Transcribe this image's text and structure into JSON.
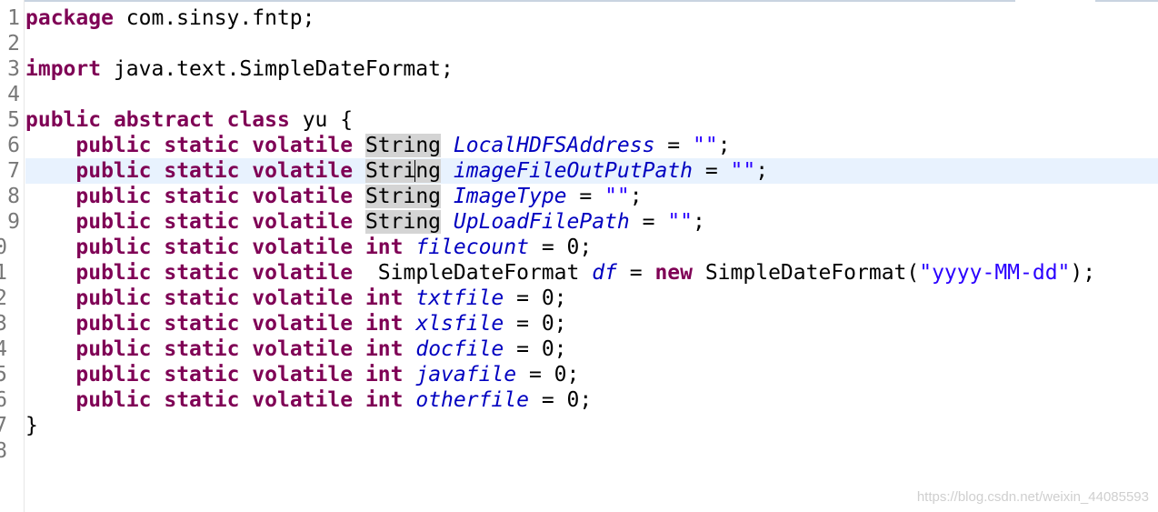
{
  "editor": {
    "current_line_index": 6,
    "colors": {
      "keyword": "#7f0055",
      "field": "#0000c0",
      "string": "#2a00ff",
      "line_number": "#787878",
      "current_line": "#e8f2fe",
      "occurrence_highlight": "#d4d4d4"
    },
    "lines": [
      {
        "num": "1",
        "tokens": [
          {
            "t": "kw",
            "v": "package"
          },
          {
            "t": "plain",
            "v": " com.sinsy.fntp;"
          }
        ]
      },
      {
        "num": "2",
        "tokens": []
      },
      {
        "num": "3",
        "tokens": [
          {
            "t": "kw",
            "v": "import"
          },
          {
            "t": "plain",
            "v": " java.text.SimpleDateFormat;"
          }
        ]
      },
      {
        "num": "4",
        "tokens": []
      },
      {
        "num": "5",
        "tokens": [
          {
            "t": "kw",
            "v": "public"
          },
          {
            "t": "plain",
            "v": " "
          },
          {
            "t": "kw",
            "v": "abstract"
          },
          {
            "t": "plain",
            "v": " "
          },
          {
            "t": "kw",
            "v": "class"
          },
          {
            "t": "plain",
            "v": " yu {"
          }
        ]
      },
      {
        "num": "6",
        "tokens": [
          {
            "t": "plain",
            "v": "    "
          },
          {
            "t": "kw",
            "v": "public"
          },
          {
            "t": "plain",
            "v": " "
          },
          {
            "t": "kw",
            "v": "static"
          },
          {
            "t": "plain",
            "v": " "
          },
          {
            "t": "kw",
            "v": "volatile"
          },
          {
            "t": "plain",
            "v": " "
          },
          {
            "t": "hl",
            "v": "String"
          },
          {
            "t": "plain",
            "v": " "
          },
          {
            "t": "fld",
            "v": "LocalHDFSAddress"
          },
          {
            "t": "plain",
            "v": " = "
          },
          {
            "t": "str",
            "v": "\"\""
          },
          {
            "t": "plain",
            "v": ";"
          }
        ]
      },
      {
        "num": "7",
        "tokens": [
          {
            "t": "plain",
            "v": "    "
          },
          {
            "t": "kw",
            "v": "public"
          },
          {
            "t": "plain",
            "v": " "
          },
          {
            "t": "kw",
            "v": "static"
          },
          {
            "t": "plain",
            "v": " "
          },
          {
            "t": "kw",
            "v": "volatile"
          },
          {
            "t": "plain",
            "v": " "
          },
          {
            "t": "hl",
            "v": "Stri"
          },
          {
            "t": "caret",
            "v": ""
          },
          {
            "t": "hl",
            "v": "ng"
          },
          {
            "t": "plain",
            "v": " "
          },
          {
            "t": "fld",
            "v": "imageFileOutPutPath"
          },
          {
            "t": "plain",
            "v": " = "
          },
          {
            "t": "str",
            "v": "\"\""
          },
          {
            "t": "plain",
            "v": ";"
          }
        ]
      },
      {
        "num": "8",
        "tokens": [
          {
            "t": "plain",
            "v": "    "
          },
          {
            "t": "kw",
            "v": "public"
          },
          {
            "t": "plain",
            "v": " "
          },
          {
            "t": "kw",
            "v": "static"
          },
          {
            "t": "plain",
            "v": " "
          },
          {
            "t": "kw",
            "v": "volatile"
          },
          {
            "t": "plain",
            "v": " "
          },
          {
            "t": "hl",
            "v": "String"
          },
          {
            "t": "plain",
            "v": " "
          },
          {
            "t": "fld",
            "v": "ImageType"
          },
          {
            "t": "plain",
            "v": " = "
          },
          {
            "t": "str",
            "v": "\"\""
          },
          {
            "t": "plain",
            "v": ";"
          }
        ]
      },
      {
        "num": "9",
        "tokens": [
          {
            "t": "plain",
            "v": "    "
          },
          {
            "t": "kw",
            "v": "public"
          },
          {
            "t": "plain",
            "v": " "
          },
          {
            "t": "kw",
            "v": "static"
          },
          {
            "t": "plain",
            "v": " "
          },
          {
            "t": "kw",
            "v": "volatile"
          },
          {
            "t": "plain",
            "v": " "
          },
          {
            "t": "hl",
            "v": "String"
          },
          {
            "t": "plain",
            "v": " "
          },
          {
            "t": "fld",
            "v": "UpLoadFilePath"
          },
          {
            "t": "plain",
            "v": " = "
          },
          {
            "t": "str",
            "v": "\"\""
          },
          {
            "t": "plain",
            "v": ";"
          }
        ]
      },
      {
        "num": "0",
        "tokens": [
          {
            "t": "plain",
            "v": "    "
          },
          {
            "t": "kw",
            "v": "public"
          },
          {
            "t": "plain",
            "v": " "
          },
          {
            "t": "kw",
            "v": "static"
          },
          {
            "t": "plain",
            "v": " "
          },
          {
            "t": "kw",
            "v": "volatile"
          },
          {
            "t": "plain",
            "v": " "
          },
          {
            "t": "kw",
            "v": "int"
          },
          {
            "t": "plain",
            "v": " "
          },
          {
            "t": "fld",
            "v": "filecount"
          },
          {
            "t": "plain",
            "v": " = 0;"
          }
        ]
      },
      {
        "num": "1",
        "tokens": [
          {
            "t": "plain",
            "v": "    "
          },
          {
            "t": "kw",
            "v": "public"
          },
          {
            "t": "plain",
            "v": " "
          },
          {
            "t": "kw",
            "v": "static"
          },
          {
            "t": "plain",
            "v": " "
          },
          {
            "t": "kw",
            "v": "volatile"
          },
          {
            "t": "plain",
            "v": "  SimpleDateFormat "
          },
          {
            "t": "fld",
            "v": "df"
          },
          {
            "t": "plain",
            "v": " = "
          },
          {
            "t": "kw",
            "v": "new"
          },
          {
            "t": "plain",
            "v": " SimpleDateFormat("
          },
          {
            "t": "str",
            "v": "\"yyyy-MM-dd\""
          },
          {
            "t": "plain",
            "v": ");"
          }
        ]
      },
      {
        "num": "2",
        "tokens": [
          {
            "t": "plain",
            "v": "    "
          },
          {
            "t": "kw",
            "v": "public"
          },
          {
            "t": "plain",
            "v": " "
          },
          {
            "t": "kw",
            "v": "static"
          },
          {
            "t": "plain",
            "v": " "
          },
          {
            "t": "kw",
            "v": "volatile"
          },
          {
            "t": "plain",
            "v": " "
          },
          {
            "t": "kw",
            "v": "int"
          },
          {
            "t": "plain",
            "v": " "
          },
          {
            "t": "fld",
            "v": "txtfile"
          },
          {
            "t": "plain",
            "v": " = 0;"
          }
        ]
      },
      {
        "num": "3",
        "tokens": [
          {
            "t": "plain",
            "v": "    "
          },
          {
            "t": "kw",
            "v": "public"
          },
          {
            "t": "plain",
            "v": " "
          },
          {
            "t": "kw",
            "v": "static"
          },
          {
            "t": "plain",
            "v": " "
          },
          {
            "t": "kw",
            "v": "volatile"
          },
          {
            "t": "plain",
            "v": " "
          },
          {
            "t": "kw",
            "v": "int"
          },
          {
            "t": "plain",
            "v": " "
          },
          {
            "t": "fld",
            "v": "xlsfile"
          },
          {
            "t": "plain",
            "v": " = 0;"
          }
        ]
      },
      {
        "num": "4",
        "tokens": [
          {
            "t": "plain",
            "v": "    "
          },
          {
            "t": "kw",
            "v": "public"
          },
          {
            "t": "plain",
            "v": " "
          },
          {
            "t": "kw",
            "v": "static"
          },
          {
            "t": "plain",
            "v": " "
          },
          {
            "t": "kw",
            "v": "volatile"
          },
          {
            "t": "plain",
            "v": " "
          },
          {
            "t": "kw",
            "v": "int"
          },
          {
            "t": "plain",
            "v": " "
          },
          {
            "t": "fld",
            "v": "docfile"
          },
          {
            "t": "plain",
            "v": " = 0;"
          }
        ]
      },
      {
        "num": "5",
        "tokens": [
          {
            "t": "plain",
            "v": "    "
          },
          {
            "t": "kw",
            "v": "public"
          },
          {
            "t": "plain",
            "v": " "
          },
          {
            "t": "kw",
            "v": "static"
          },
          {
            "t": "plain",
            "v": " "
          },
          {
            "t": "kw",
            "v": "volatile"
          },
          {
            "t": "plain",
            "v": " "
          },
          {
            "t": "kw",
            "v": "int"
          },
          {
            "t": "plain",
            "v": " "
          },
          {
            "t": "fld",
            "v": "javafile"
          },
          {
            "t": "plain",
            "v": " = 0;"
          }
        ]
      },
      {
        "num": "6",
        "tokens": [
          {
            "t": "plain",
            "v": "    "
          },
          {
            "t": "kw",
            "v": "public"
          },
          {
            "t": "plain",
            "v": " "
          },
          {
            "t": "kw",
            "v": "static"
          },
          {
            "t": "plain",
            "v": " "
          },
          {
            "t": "kw",
            "v": "volatile"
          },
          {
            "t": "plain",
            "v": " "
          },
          {
            "t": "kw",
            "v": "int"
          },
          {
            "t": "plain",
            "v": " "
          },
          {
            "t": "fld",
            "v": "otherfile"
          },
          {
            "t": "plain",
            "v": " = 0;"
          }
        ]
      },
      {
        "num": "7",
        "tokens": [
          {
            "t": "plain",
            "v": "}"
          }
        ]
      },
      {
        "num": "8",
        "tokens": []
      }
    ]
  },
  "watermark": {
    "text": "https://blog.csdn.net/weixin_44085593"
  }
}
